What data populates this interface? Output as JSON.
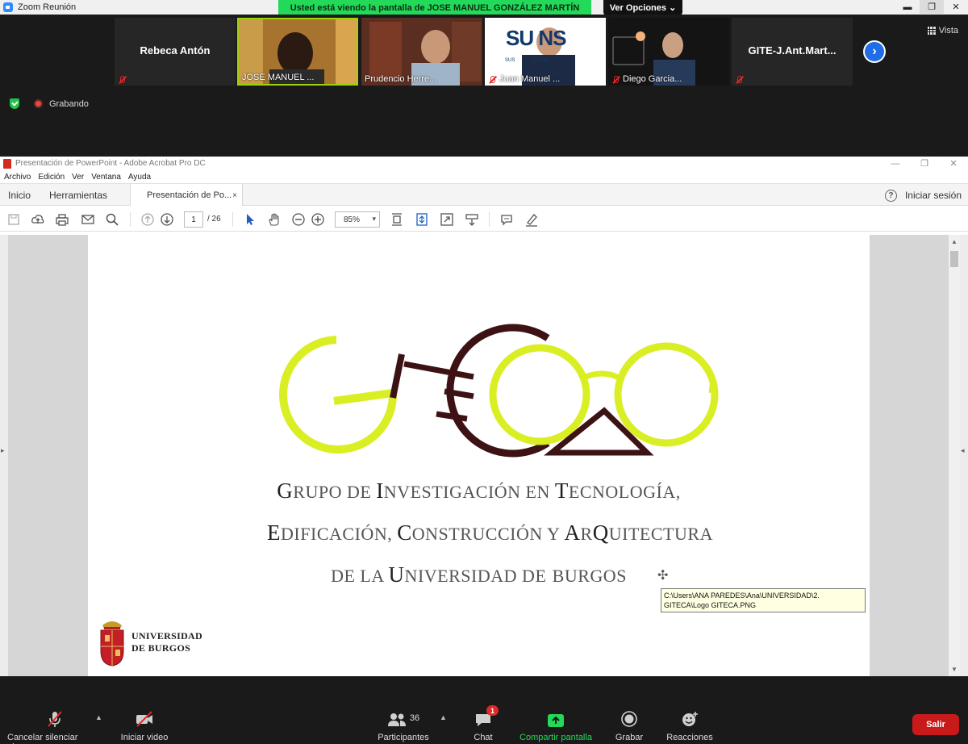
{
  "window": {
    "title": "Zoom Reunión"
  },
  "share_banner": {
    "text": "Usted está viendo la pantalla de JOSE MANUEL GONZÁLEZ MARTÍN",
    "view_options": "Ver Opciones ⌄"
  },
  "gallery": {
    "tiles": [
      {
        "name": "Rebeca Antón",
        "label": ""
      },
      {
        "name": "",
        "label": "JOSE MANUEL ..."
      },
      {
        "name": "",
        "label": "Prudencio Herre..."
      },
      {
        "name": "",
        "label": "Juan Manuel ..."
      },
      {
        "name": "",
        "label": "Diego Garcia..."
      },
      {
        "name": "GITE-J.Ant.Mart...",
        "label": ""
      }
    ],
    "vista": "Vista",
    "recording": "Grabando",
    "suvins_text": "SU  NS",
    "suvins_sub": "SUS             CTION"
  },
  "acrobat": {
    "title": "Presentación de PowerPoint - Adobe Acrobat Pro DC",
    "menu": [
      "Archivo",
      "Edición",
      "Ver",
      "Ventana",
      "Ayuda"
    ],
    "tabs": {
      "home": "Inicio",
      "tools": "Herramientas",
      "file": "Presentación de Po...",
      "close": "×"
    },
    "sign_in": "Iniciar sesión",
    "page_current": "1",
    "page_total": "/ 26",
    "zoom": "85%",
    "close_x": "✕",
    "min": "—",
    "restore": "❐"
  },
  "slide": {
    "line1_parts": [
      {
        "b": "G",
        "t": "RUPO DE "
      },
      {
        "b": "I",
        "t": "NVESTIGACIÓN EN "
      },
      {
        "b": "T",
        "t": "ECNOLOGÍA,"
      }
    ],
    "line1": "GRUPO DE INVESTIGACIÓN EN TECNOLOGÍA,",
    "line2": "EDIFICACIÓN, CONSTRUCCIÓN Y ARQUITECTURA",
    "line3": "DE LA UNIVERSIDAD DE BURGOS",
    "tooltip": "C:\\Users\\ANA PAREDES\\Ana\\UNIVERSIDAD\\2. GITECA\\Logo GITECA.PNG",
    "university_line1": "UNIVERSIDAD",
    "university_line2": "DE BURGOS",
    "logo_colors": {
      "lime": "#d9ef24",
      "maroon": "#3d1214"
    }
  },
  "zoom_toolbar": {
    "unmute": "Cancelar silenciar ahora",
    "video": "Iniciar video",
    "participants": "Participantes",
    "participants_count": "36",
    "chat": "Chat",
    "chat_badge": "1",
    "share": "Compartir pantalla",
    "record": "Grabar",
    "reactions": "Reacciones",
    "leave": "Salir"
  }
}
